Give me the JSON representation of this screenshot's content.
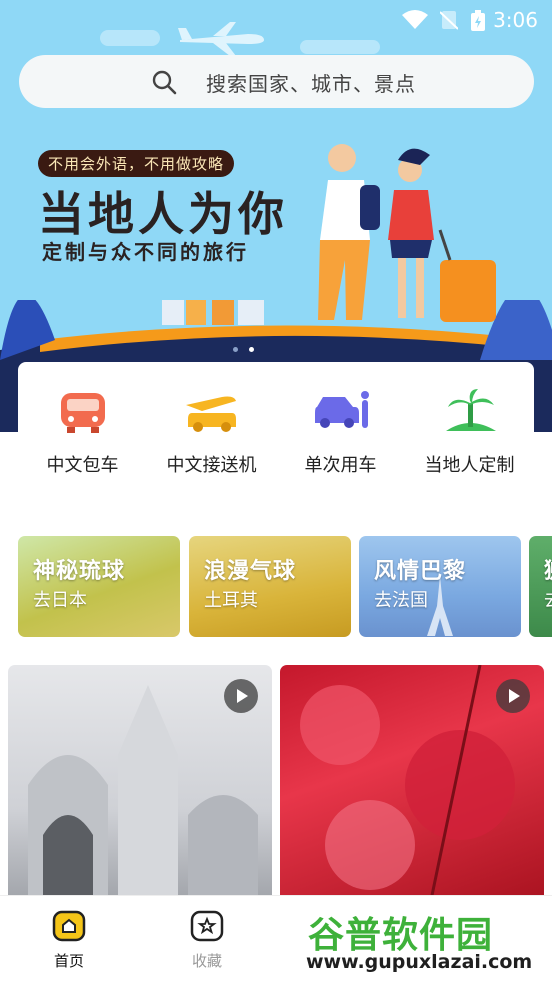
{
  "status_bar": {
    "time": "3:06"
  },
  "search": {
    "placeholder": "搜索国家、城市、景点"
  },
  "banner": {
    "tag": "不用会外语，不用做攻略",
    "headline": "当地人为你",
    "subline": "定制与众不同的旅行",
    "slide_count": 2,
    "active_slide": 2
  },
  "services": [
    {
      "label": "中文包车",
      "icon": "bus-icon",
      "color": "#f26b4e"
    },
    {
      "label": "中文接送机",
      "icon": "airport-car-icon",
      "color": "#f7b521"
    },
    {
      "label": "单次用车",
      "icon": "single-ride-icon",
      "color": "#6b6ae8"
    },
    {
      "label": "当地人定制",
      "icon": "island-icon",
      "color": "#3fbf5a"
    }
  ],
  "promos": [
    {
      "title": "神秘琉球",
      "subtitle": "去日本"
    },
    {
      "title": "浪漫气球",
      "subtitle": "土耳其"
    },
    {
      "title": "风情巴黎",
      "subtitle": "去法国"
    },
    {
      "title": "狮",
      "subtitle": "去"
    }
  ],
  "tabs": [
    {
      "label": "首页",
      "icon": "home-icon",
      "active": true
    },
    {
      "label": "收藏",
      "icon": "favorites-icon",
      "active": false
    }
  ],
  "watermark": {
    "brand": "谷普软件园",
    "url": "www.gupuxlazai.com"
  },
  "colors": {
    "accent": "#f5c518",
    "sky": "#8fd8f6"
  }
}
